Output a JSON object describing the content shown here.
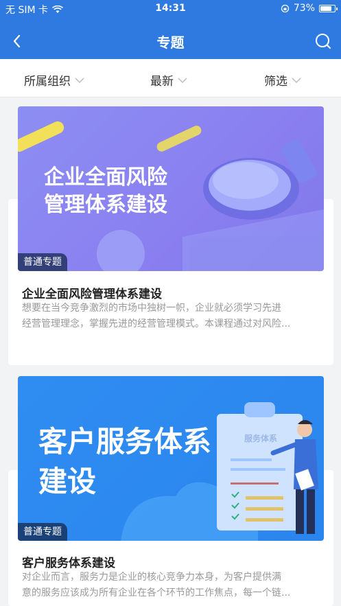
{
  "status": {
    "carrier": "无 SIM 卡",
    "time": "14:31",
    "battery": "73%"
  },
  "nav": {
    "title": "专题"
  },
  "filters": [
    "所属组织",
    "最新",
    "筛选"
  ],
  "cards": [
    {
      "banner_line1": "企业全面风险",
      "banner_line2": "管理体系建设",
      "badge": "普通专题",
      "title": "企业全面风险管理体系建设",
      "desc_line1": "想要在当今竞争激烈的市场中独树一帜，企业就必须学习先进",
      "desc_line2": "经营管理理念，掌握先进的经营管理模式。本课程通过对风险..."
    },
    {
      "banner_line1": "客户服务体系",
      "banner_line2": "建设",
      "banner_board": "服务体系",
      "badge": "普通专题",
      "title": "客户服务体系建设",
      "desc_line1": "对企业而言，服务力是企业的核心竞争力本身，为客户提供满",
      "desc_line2": "意的服务应该成为所有企业在各个环节的工作焦点，每一个链..."
    }
  ],
  "colors": {
    "header": "#2f7ae0",
    "card1_banner": "#8f8ff2",
    "card2_banner": "#2b8cf0"
  }
}
